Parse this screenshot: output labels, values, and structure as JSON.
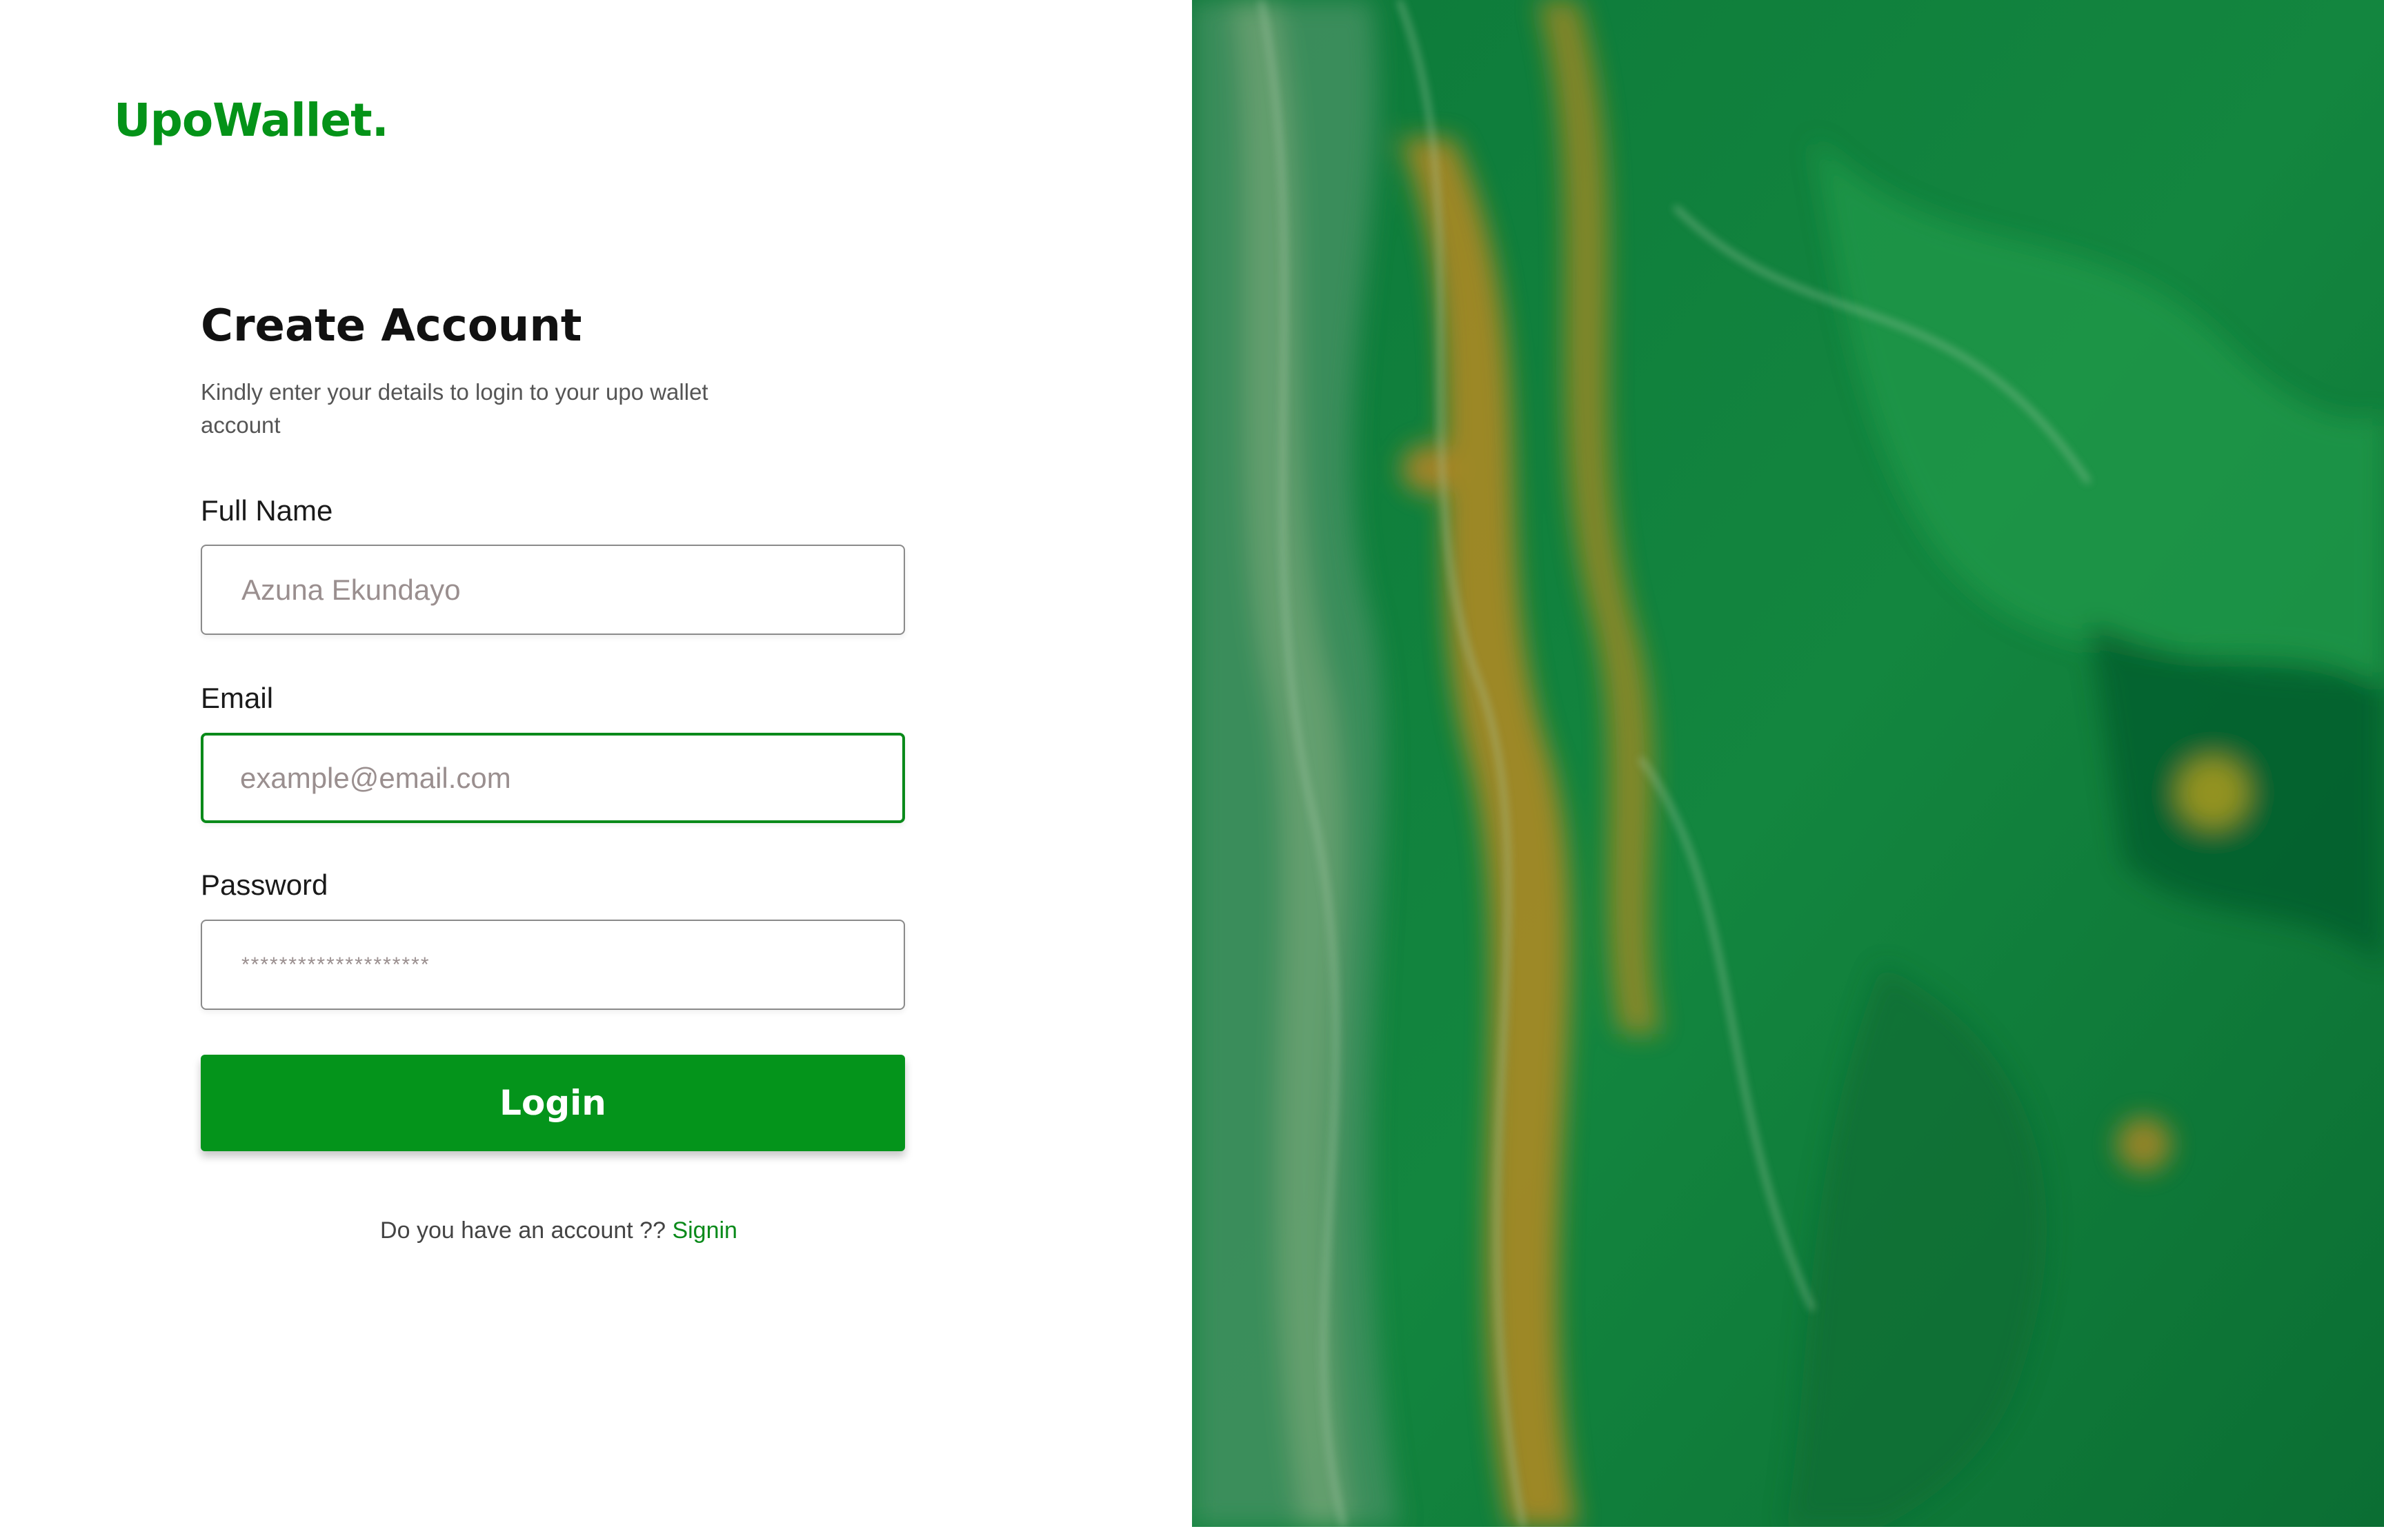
{
  "brand": {
    "name": "UpoWallet."
  },
  "form": {
    "title": "Create Account",
    "subtitle": "Kindly enter your details to login to your  upo wallet account",
    "full_name": {
      "label": "Full Name",
      "placeholder": "Azuna Ekundayo"
    },
    "email": {
      "label": "Email",
      "placeholder": "example@email.com"
    },
    "password": {
      "label": "Password",
      "placeholder": "********************"
    },
    "submit_label": "Login",
    "footer_text": "Do you have an account ??",
    "footer_link": "Signin"
  },
  "colors": {
    "brand": "#049318",
    "button": "#04941b",
    "active_border": "#0a8a1a",
    "art_base": "#0f7f3b",
    "art_accent": "#c98a1e"
  }
}
